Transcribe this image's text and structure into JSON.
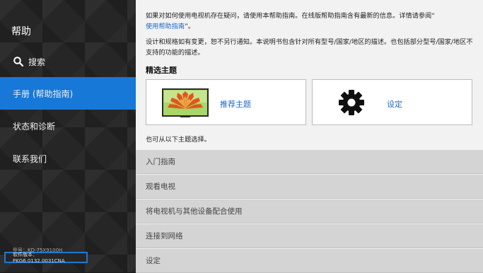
{
  "sidebar": {
    "title": "帮助",
    "items": [
      {
        "label": "搜索",
        "icon": "search-icon"
      },
      {
        "label": "手册 (帮助指南)",
        "active": true
      },
      {
        "label": "状态和诊断"
      },
      {
        "label": "联系我们"
      }
    ],
    "model_text": "型号：KD-75X9100H",
    "version_text": "软件版本： PKG6.0132.0031CNA"
  },
  "main": {
    "intro_text": "如果对如何使用电视机存在疑问，请使用本帮助指南。在线版帮助指南含有最新的信息。详情请参阅“",
    "intro_link": "使用帮助指南",
    "intro_link_suffix": "”。",
    "notice_text": "设计和规格如有变更，恕不另行通知。本说明书包含针对所有型号/国家/地区的描述。也包括部分型号/国家/地区不支持的功能的描述。",
    "featured_title": "精选主题",
    "cards": [
      {
        "label": "推荐主题",
        "icon": "tv-flower-icon"
      },
      {
        "label": "设定",
        "icon": "gear-icon"
      }
    ],
    "also_text": "也可从以下主题选择。",
    "topics": [
      "入门指南",
      "观看电视",
      "将电视机与其他设备配合使用",
      "连接到网络",
      "设定"
    ]
  },
  "colors": {
    "accent": "#1778d8",
    "link": "#1e66c8",
    "sidebar_bg": "#262626",
    "topic_bg": "#d4d4d4"
  }
}
